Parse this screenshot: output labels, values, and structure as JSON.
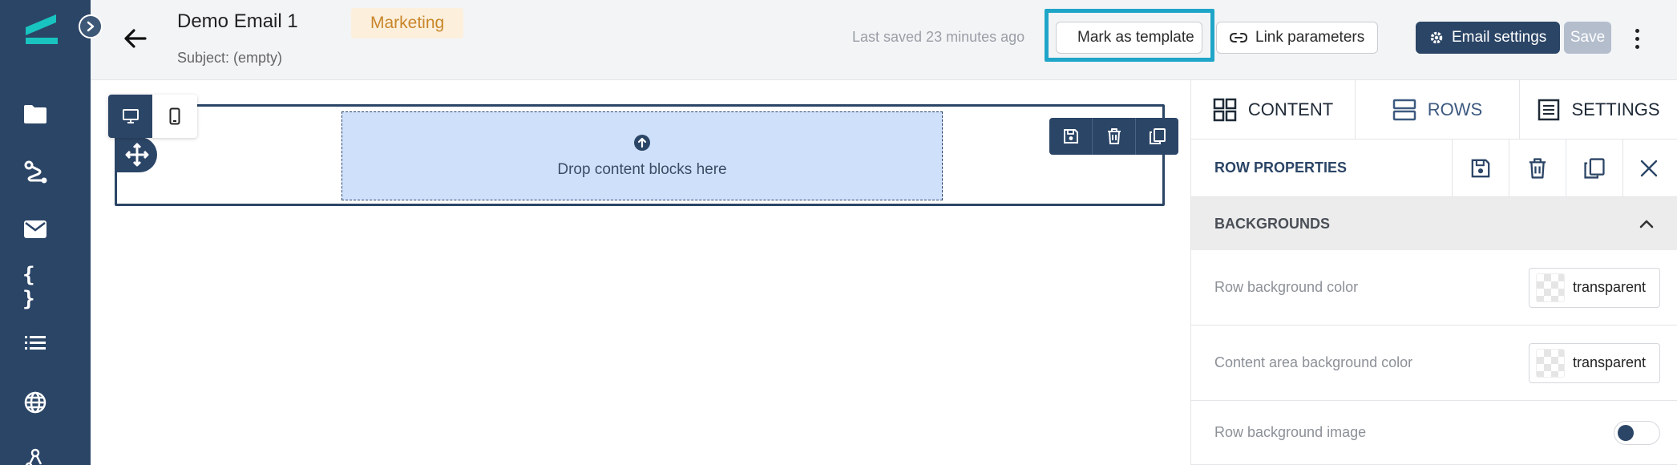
{
  "header": {
    "title": "Demo Email 1",
    "subject": "Subject: (empty)",
    "tag": "Marketing",
    "last_saved": "Last saved 23 minutes ago",
    "mark_template_label": "Mark as template",
    "link_params_label": "Link parameters",
    "email_settings_label": "Email settings",
    "save_label": "Save"
  },
  "sidebar": {
    "items": [
      {
        "icon": "folder-icon"
      },
      {
        "icon": "journey-icon"
      },
      {
        "icon": "mail-icon"
      },
      {
        "icon": "braces-icon",
        "glyph": "{ }"
      },
      {
        "icon": "list-icon"
      },
      {
        "icon": "globe-icon"
      },
      {
        "icon": "webhook-icon"
      }
    ]
  },
  "canvas": {
    "drop_text": "Drop content blocks here"
  },
  "panel": {
    "tabs": [
      {
        "label": "CONTENT"
      },
      {
        "label": "ROWS"
      },
      {
        "label": "SETTINGS"
      }
    ],
    "row_properties_title": "ROW PROPERTIES",
    "section_title": "BACKGROUNDS",
    "props": [
      {
        "label": "Row background color",
        "value": "transparent"
      },
      {
        "label": "Content area background color",
        "value": "transparent"
      },
      {
        "label": "Row background image",
        "enabled": false
      }
    ]
  },
  "colors": {
    "primary": "#2b4566",
    "accent": "#1fa5c8",
    "logo": "#19c3c0",
    "tag_bg": "#fcefdc",
    "tag_text": "#c8862a",
    "drop_zone": "#cfe0fb"
  }
}
